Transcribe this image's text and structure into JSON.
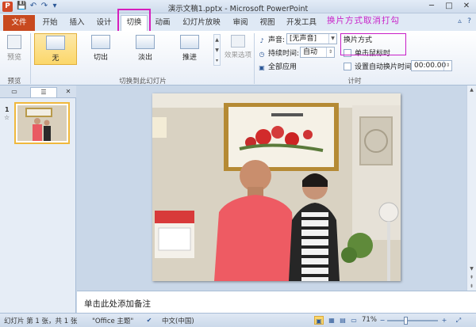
{
  "window": {
    "title": "演示文稿1.pptx - Microsoft PowerPoint",
    "app_icon": "P",
    "minimize": "─",
    "maximize": "□",
    "close": "✕"
  },
  "qat": {
    "save": "💾",
    "undo": "↶",
    "redo": "↷",
    "more": "▾"
  },
  "tabs": {
    "file": "文件",
    "items": [
      "开始",
      "插入",
      "设计",
      "切换",
      "动画",
      "幻灯片放映",
      "审阅",
      "视图",
      "开发工具"
    ],
    "active": "切换"
  },
  "annotation": "换片方式取消打勾",
  "ribbon": {
    "preview": {
      "label": "预览",
      "group": "预览"
    },
    "transitions": {
      "group": "切换到此幻灯片",
      "items": [
        "无",
        "切出",
        "淡出",
        "推进"
      ],
      "selected": "无",
      "effect_options": "效果选项"
    },
    "timing": {
      "group": "计时",
      "sound_label": "声音:",
      "sound_value": "[无声音]",
      "duration_label": "持续时间:",
      "duration_value": "自动",
      "apply_all": "全部应用",
      "advance_title": "换片方式",
      "on_click": "单击鼠标时",
      "after_label": "设置自动换片时间:",
      "after_value": "00:00.00"
    }
  },
  "left_panel": {
    "close": "✕",
    "slide_number": "1",
    "star": "☆"
  },
  "notes": {
    "placeholder": "单击此处添加备注"
  },
  "status": {
    "slide_info": "幻灯片 第 1 张，共 1 张",
    "theme": "\"Office 主题\"",
    "language": "中文(中国)",
    "zoom": "71%"
  },
  "colors": {
    "accent_highlight": "#d61fbd",
    "file_tab": "#c8491f",
    "selected_button": "#fbd76a"
  }
}
